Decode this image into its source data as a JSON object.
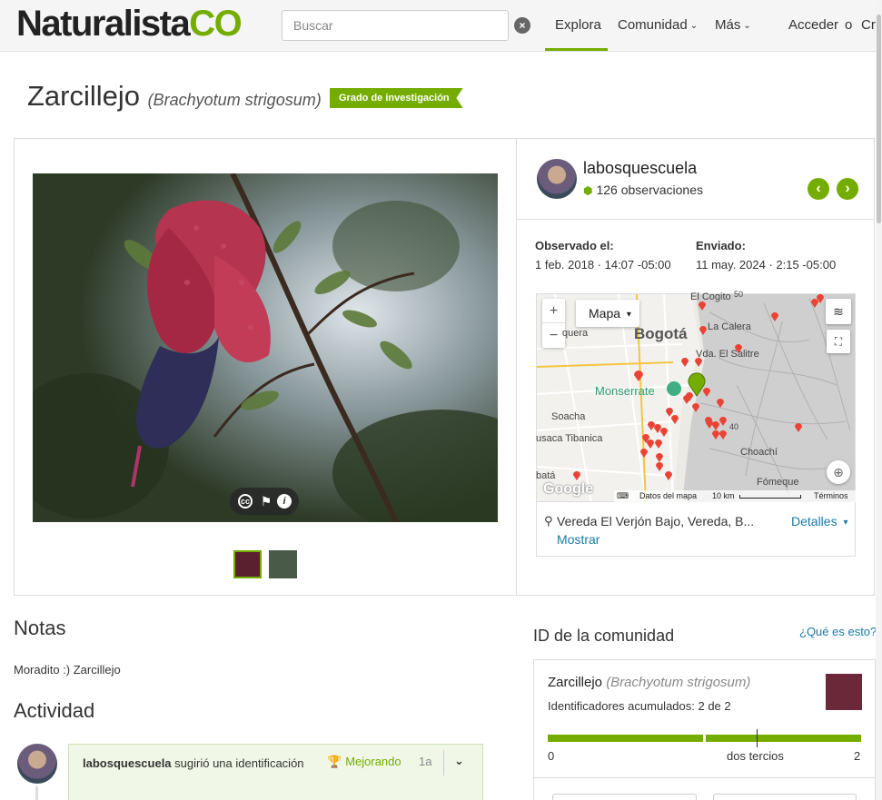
{
  "header": {
    "logo_main": "Naturalista",
    "logo_accent": "CO",
    "search_placeholder": "Buscar",
    "nav": {
      "explora": "Explora",
      "comunidad": "Comunidad",
      "mas": "Más",
      "acceder": "Acceder",
      "o": "o",
      "crear": "Cr"
    }
  },
  "observation": {
    "common_name": "Zarcillejo",
    "scientific_name": "(Brachyotum strigosum)",
    "quality_badge": "Grado de investigación",
    "user": {
      "name": "labosquescuela",
      "observations": "126 observaciones"
    },
    "observed_label": "Observado el:",
    "observed_value": "1 feb. 2018 · 14:07 -05:00",
    "submitted_label": "Enviado:",
    "submitted_value": "11 may. 2024 · 2:15 -05:00"
  },
  "map": {
    "type_label": "Mapa",
    "zoom_in": "+",
    "zoom_out": "−",
    "labels": {
      "bogota": "Bogotá",
      "calera": "La Calera",
      "salitre": "Vda. El Salitre",
      "monserrate": "Monserrate",
      "soacha": "Soacha",
      "tibanica": "usaca Tibanica",
      "choachi": "Choachí",
      "fomeque": "Fómeque",
      "cogito": "El Cogito",
      "quera": "quera",
      "bate": "batá",
      "road40": "40",
      "road50": "50"
    },
    "google": "Google",
    "footer": {
      "data": "Datos del mapa",
      "scale": "10 km",
      "terms": "Términos"
    },
    "location": "Vereda El Verjón Bajo, Vereda, B...",
    "show": "Mostrar",
    "details": "Detalles"
  },
  "notes": {
    "heading": "Notas",
    "text": "Moradito :) Zarcillejo"
  },
  "activity": {
    "heading": "Actividad",
    "user": "labosquescuela",
    "action": " sugirió una identificación",
    "status": "Mejorando",
    "time": "1a"
  },
  "community_id": {
    "heading": "ID de la comunidad",
    "help": "¿Qué es esto?",
    "taxon_common": "Zarcillejo",
    "taxon_sci": "(Brachyotum strigosum)",
    "accumulated": "Identificadores acumulados: 2 de 2",
    "agreement_fraction": 1.0,
    "bar_min": "0",
    "bar_mid": "dos tercios",
    "bar_max": "2"
  },
  "colors": {
    "accent": "#74ac00",
    "link": "#1a7aa5"
  }
}
